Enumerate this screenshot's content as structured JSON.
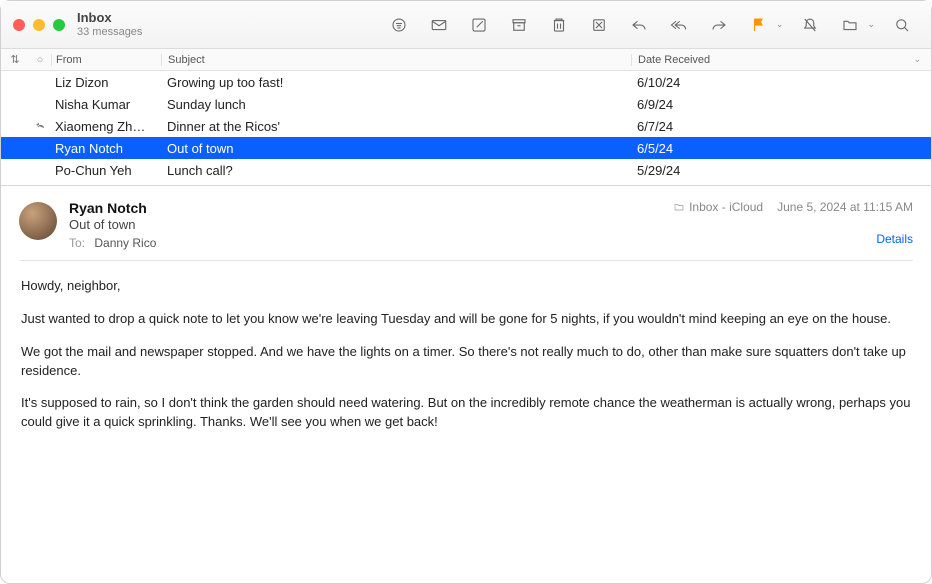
{
  "window": {
    "title": "Inbox",
    "subtitle": "33 messages"
  },
  "columns": {
    "from": "From",
    "subject": "Subject",
    "date": "Date Received"
  },
  "messages": [
    {
      "from": "Liz Dizon",
      "subject": "Growing up too fast!",
      "date": "6/10/24",
      "replied": false,
      "selected": false
    },
    {
      "from": "Nisha Kumar",
      "subject": "Sunday lunch",
      "date": "6/9/24",
      "replied": false,
      "selected": false
    },
    {
      "from": "Xiaomeng Zh…",
      "subject": "Dinner at the Ricos'",
      "date": "6/7/24",
      "replied": true,
      "selected": false
    },
    {
      "from": "Ryan Notch",
      "subject": "Out of town",
      "date": "6/5/24",
      "replied": false,
      "selected": true
    },
    {
      "from": "Po-Chun Yeh",
      "subject": "Lunch call?",
      "date": "5/29/24",
      "replied": false,
      "selected": false
    }
  ],
  "preview": {
    "from": "Ryan Notch",
    "subject": "Out of town",
    "to_label": "To:",
    "to": "Danny Rico",
    "folder": "Inbox - iCloud",
    "timestamp": "June 5, 2024 at 11:15 AM",
    "details": "Details",
    "body": [
      "Howdy, neighbor,",
      "Just wanted to drop a quick note to let you know we're leaving Tuesday and will be gone for 5 nights, if you wouldn't mind keeping an eye on the house.",
      "We got the mail and newspaper stopped. And we have the lights on a timer. So there's not really much to do, other than make sure squatters don't take up residence.",
      "It's supposed to rain, so I don't think the garden should need watering. But on the incredibly remote chance the weatherman is actually wrong, perhaps you could give it a quick sprinkling. Thanks. We'll see you when we get back!"
    ]
  }
}
